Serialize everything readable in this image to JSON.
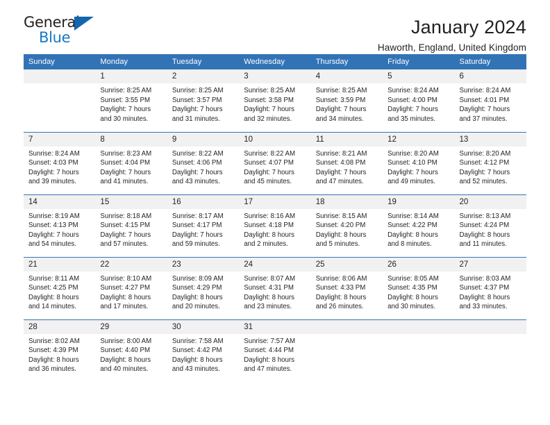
{
  "brand": {
    "name_top": "General",
    "name_bottom": "Blue",
    "accent_color": "#1878c6",
    "triangle_color": "#1366ab"
  },
  "header": {
    "title": "January 2024",
    "subtitle": "Haworth, England, United Kingdom"
  },
  "theme": {
    "header_row_bg": "#3273b6",
    "daynum_bg": "#f1f1f1",
    "text_color": "#231f20",
    "page_bg": "#ffffff"
  },
  "weekday_headers": [
    "Sunday",
    "Monday",
    "Tuesday",
    "Wednesday",
    "Thursday",
    "Friday",
    "Saturday"
  ],
  "labels": {
    "sunrise_prefix": "Sunrise:",
    "sunset_prefix": "Sunset:",
    "daylight_prefix": "Daylight:"
  },
  "weeks": [
    [
      {
        "day": "",
        "sunrise": "",
        "sunset": "",
        "daylight_line1": "",
        "daylight_line2": "",
        "empty": true
      },
      {
        "day": "1",
        "sunrise": "Sunrise: 8:25 AM",
        "sunset": "Sunset: 3:55 PM",
        "daylight_line1": "Daylight: 7 hours",
        "daylight_line2": "and 30 minutes."
      },
      {
        "day": "2",
        "sunrise": "Sunrise: 8:25 AM",
        "sunset": "Sunset: 3:57 PM",
        "daylight_line1": "Daylight: 7 hours",
        "daylight_line2": "and 31 minutes."
      },
      {
        "day": "3",
        "sunrise": "Sunrise: 8:25 AM",
        "sunset": "Sunset: 3:58 PM",
        "daylight_line1": "Daylight: 7 hours",
        "daylight_line2": "and 32 minutes."
      },
      {
        "day": "4",
        "sunrise": "Sunrise: 8:25 AM",
        "sunset": "Sunset: 3:59 PM",
        "daylight_line1": "Daylight: 7 hours",
        "daylight_line2": "and 34 minutes."
      },
      {
        "day": "5",
        "sunrise": "Sunrise: 8:24 AM",
        "sunset": "Sunset: 4:00 PM",
        "daylight_line1": "Daylight: 7 hours",
        "daylight_line2": "and 35 minutes."
      },
      {
        "day": "6",
        "sunrise": "Sunrise: 8:24 AM",
        "sunset": "Sunset: 4:01 PM",
        "daylight_line1": "Daylight: 7 hours",
        "daylight_line2": "and 37 minutes."
      }
    ],
    [
      {
        "day": "7",
        "sunrise": "Sunrise: 8:24 AM",
        "sunset": "Sunset: 4:03 PM",
        "daylight_line1": "Daylight: 7 hours",
        "daylight_line2": "and 39 minutes."
      },
      {
        "day": "8",
        "sunrise": "Sunrise: 8:23 AM",
        "sunset": "Sunset: 4:04 PM",
        "daylight_line1": "Daylight: 7 hours",
        "daylight_line2": "and 41 minutes."
      },
      {
        "day": "9",
        "sunrise": "Sunrise: 8:22 AM",
        "sunset": "Sunset: 4:06 PM",
        "daylight_line1": "Daylight: 7 hours",
        "daylight_line2": "and 43 minutes."
      },
      {
        "day": "10",
        "sunrise": "Sunrise: 8:22 AM",
        "sunset": "Sunset: 4:07 PM",
        "daylight_line1": "Daylight: 7 hours",
        "daylight_line2": "and 45 minutes."
      },
      {
        "day": "11",
        "sunrise": "Sunrise: 8:21 AM",
        "sunset": "Sunset: 4:08 PM",
        "daylight_line1": "Daylight: 7 hours",
        "daylight_line2": "and 47 minutes."
      },
      {
        "day": "12",
        "sunrise": "Sunrise: 8:20 AM",
        "sunset": "Sunset: 4:10 PM",
        "daylight_line1": "Daylight: 7 hours",
        "daylight_line2": "and 49 minutes."
      },
      {
        "day": "13",
        "sunrise": "Sunrise: 8:20 AM",
        "sunset": "Sunset: 4:12 PM",
        "daylight_line1": "Daylight: 7 hours",
        "daylight_line2": "and 52 minutes."
      }
    ],
    [
      {
        "day": "14",
        "sunrise": "Sunrise: 8:19 AM",
        "sunset": "Sunset: 4:13 PM",
        "daylight_line1": "Daylight: 7 hours",
        "daylight_line2": "and 54 minutes."
      },
      {
        "day": "15",
        "sunrise": "Sunrise: 8:18 AM",
        "sunset": "Sunset: 4:15 PM",
        "daylight_line1": "Daylight: 7 hours",
        "daylight_line2": "and 57 minutes."
      },
      {
        "day": "16",
        "sunrise": "Sunrise: 8:17 AM",
        "sunset": "Sunset: 4:17 PM",
        "daylight_line1": "Daylight: 7 hours",
        "daylight_line2": "and 59 minutes."
      },
      {
        "day": "17",
        "sunrise": "Sunrise: 8:16 AM",
        "sunset": "Sunset: 4:18 PM",
        "daylight_line1": "Daylight: 8 hours",
        "daylight_line2": "and 2 minutes."
      },
      {
        "day": "18",
        "sunrise": "Sunrise: 8:15 AM",
        "sunset": "Sunset: 4:20 PM",
        "daylight_line1": "Daylight: 8 hours",
        "daylight_line2": "and 5 minutes."
      },
      {
        "day": "19",
        "sunrise": "Sunrise: 8:14 AM",
        "sunset": "Sunset: 4:22 PM",
        "daylight_line1": "Daylight: 8 hours",
        "daylight_line2": "and 8 minutes."
      },
      {
        "day": "20",
        "sunrise": "Sunrise: 8:13 AM",
        "sunset": "Sunset: 4:24 PM",
        "daylight_line1": "Daylight: 8 hours",
        "daylight_line2": "and 11 minutes."
      }
    ],
    [
      {
        "day": "21",
        "sunrise": "Sunrise: 8:11 AM",
        "sunset": "Sunset: 4:25 PM",
        "daylight_line1": "Daylight: 8 hours",
        "daylight_line2": "and 14 minutes."
      },
      {
        "day": "22",
        "sunrise": "Sunrise: 8:10 AM",
        "sunset": "Sunset: 4:27 PM",
        "daylight_line1": "Daylight: 8 hours",
        "daylight_line2": "and 17 minutes."
      },
      {
        "day": "23",
        "sunrise": "Sunrise: 8:09 AM",
        "sunset": "Sunset: 4:29 PM",
        "daylight_line1": "Daylight: 8 hours",
        "daylight_line2": "and 20 minutes."
      },
      {
        "day": "24",
        "sunrise": "Sunrise: 8:07 AM",
        "sunset": "Sunset: 4:31 PM",
        "daylight_line1": "Daylight: 8 hours",
        "daylight_line2": "and 23 minutes."
      },
      {
        "day": "25",
        "sunrise": "Sunrise: 8:06 AM",
        "sunset": "Sunset: 4:33 PM",
        "daylight_line1": "Daylight: 8 hours",
        "daylight_line2": "and 26 minutes."
      },
      {
        "day": "26",
        "sunrise": "Sunrise: 8:05 AM",
        "sunset": "Sunset: 4:35 PM",
        "daylight_line1": "Daylight: 8 hours",
        "daylight_line2": "and 30 minutes."
      },
      {
        "day": "27",
        "sunrise": "Sunrise: 8:03 AM",
        "sunset": "Sunset: 4:37 PM",
        "daylight_line1": "Daylight: 8 hours",
        "daylight_line2": "and 33 minutes."
      }
    ],
    [
      {
        "day": "28",
        "sunrise": "Sunrise: 8:02 AM",
        "sunset": "Sunset: 4:39 PM",
        "daylight_line1": "Daylight: 8 hours",
        "daylight_line2": "and 36 minutes."
      },
      {
        "day": "29",
        "sunrise": "Sunrise: 8:00 AM",
        "sunset": "Sunset: 4:40 PM",
        "daylight_line1": "Daylight: 8 hours",
        "daylight_line2": "and 40 minutes."
      },
      {
        "day": "30",
        "sunrise": "Sunrise: 7:58 AM",
        "sunset": "Sunset: 4:42 PM",
        "daylight_line1": "Daylight: 8 hours",
        "daylight_line2": "and 43 minutes."
      },
      {
        "day": "31",
        "sunrise": "Sunrise: 7:57 AM",
        "sunset": "Sunset: 4:44 PM",
        "daylight_line1": "Daylight: 8 hours",
        "daylight_line2": "and 47 minutes."
      },
      {
        "day": "",
        "sunrise": "",
        "sunset": "",
        "daylight_line1": "",
        "daylight_line2": "",
        "empty": true
      },
      {
        "day": "",
        "sunrise": "",
        "sunset": "",
        "daylight_line1": "",
        "daylight_line2": "",
        "empty": true
      },
      {
        "day": "",
        "sunrise": "",
        "sunset": "",
        "daylight_line1": "",
        "daylight_line2": "",
        "empty": true
      }
    ]
  ]
}
